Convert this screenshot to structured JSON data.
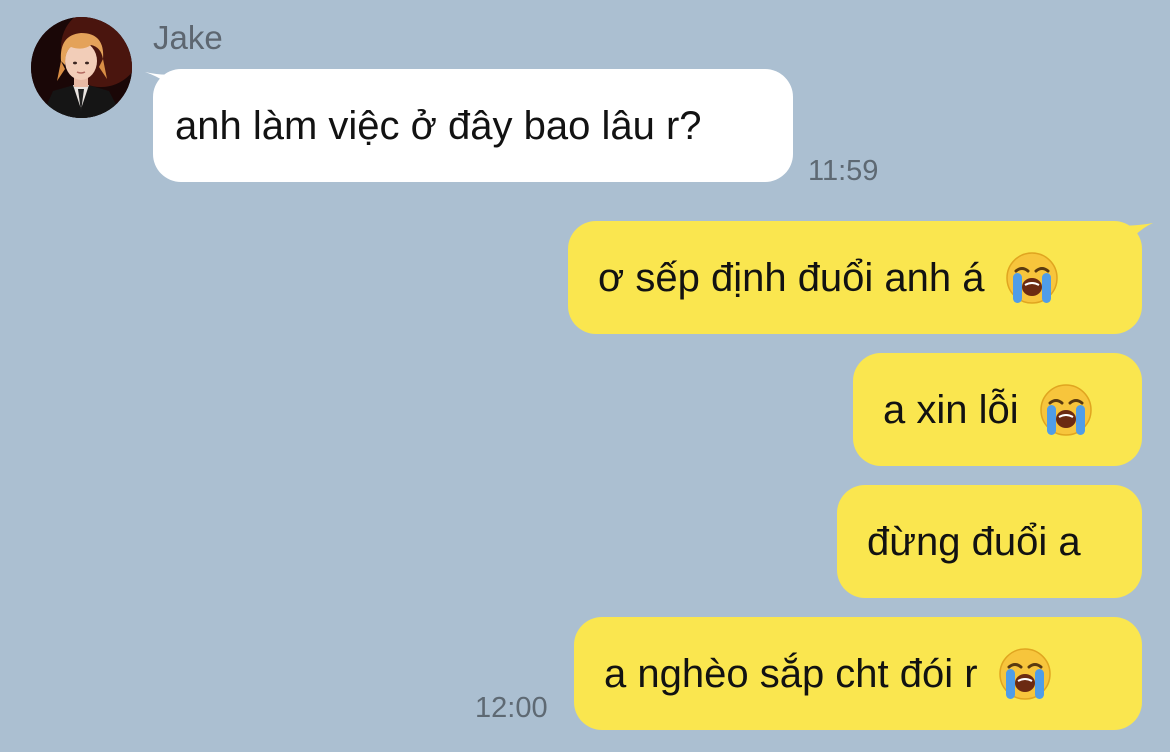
{
  "contact": {
    "name": "Jake"
  },
  "messages": [
    {
      "direction": "incoming",
      "text": "anh làm việc ở đây bao lâu r?",
      "time": "11:59"
    },
    {
      "direction": "outgoing",
      "text": "ơ sếp định đuổi anh á",
      "emoji": "loudly-crying-face"
    },
    {
      "direction": "outgoing",
      "text": "a xin lỗi",
      "emoji": "loudly-crying-face"
    },
    {
      "direction": "outgoing",
      "text": "đừng đuổi a"
    },
    {
      "direction": "outgoing",
      "text": "a nghèo sắp cht đói r",
      "emoji": "loudly-crying-face",
      "time": "12:00"
    }
  ],
  "colors": {
    "background": "#abbfd1",
    "incoming_bubble": "#ffffff",
    "outgoing_bubble": "#fae64f",
    "meta_text": "#5e6973"
  }
}
